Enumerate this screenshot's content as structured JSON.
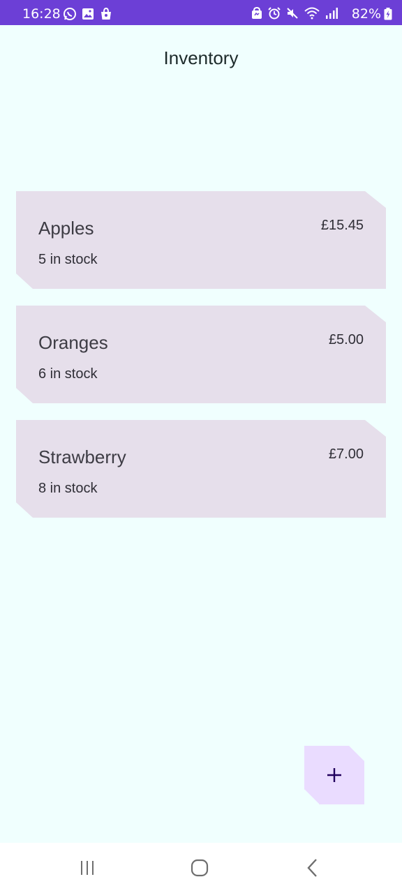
{
  "status_bar": {
    "time": "16:28",
    "battery_percent": "82%",
    "left_icons": [
      "whatsapp-icon",
      "gallery-icon",
      "shopping-bag-icon"
    ],
    "right_icons": [
      "lock-icon",
      "alarm-icon",
      "mute-icon",
      "wifi-icon",
      "signal-icon",
      "battery-charging-icon"
    ],
    "background_color": "#6c3fd6"
  },
  "app": {
    "title": "Inventory",
    "background_color": "#f0fffe"
  },
  "items": [
    {
      "name": "Apples",
      "stock": "5 in stock",
      "price": "£15.45"
    },
    {
      "name": "Oranges",
      "stock": "6 in stock",
      "price": "£5.00"
    },
    {
      "name": "Strawberry",
      "stock": "8 in stock",
      "price": "£7.00"
    }
  ],
  "card_color": "#e6dfeb",
  "fab": {
    "icon": "plus-icon",
    "color": "#eadcff"
  },
  "navigation_bar": {
    "buttons": [
      "recent-apps-icon",
      "home-icon",
      "back-icon"
    ]
  }
}
